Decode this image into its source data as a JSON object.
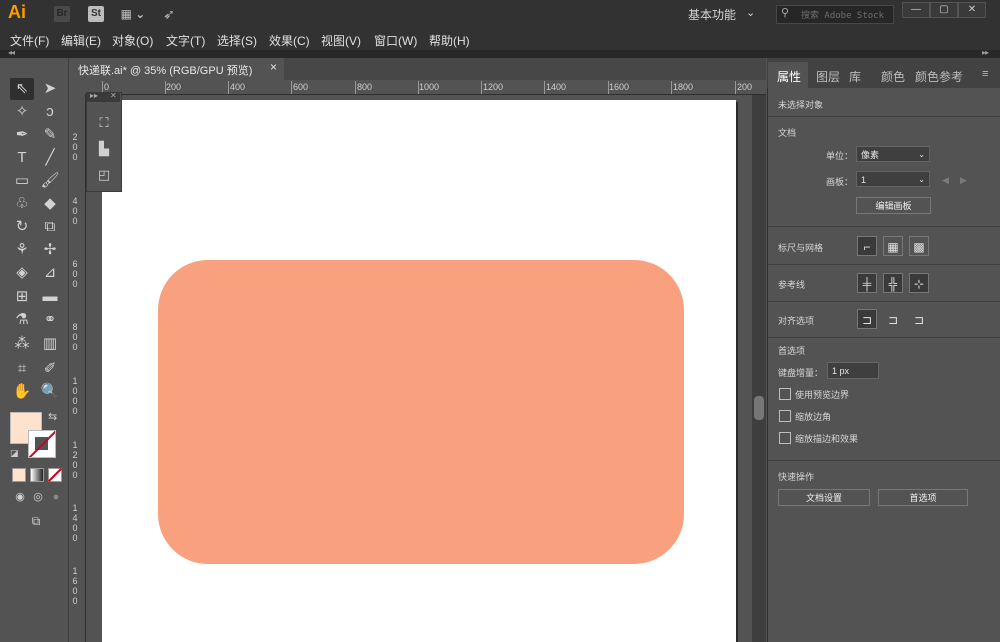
{
  "app": {
    "logo": "Ai",
    "bridge_icon": "Br",
    "stock_icon": "St",
    "layout_icon": "layout-grid-icon",
    "rocket_icon": "rocket-icon",
    "workspace": "基本功能",
    "stock_search_placeholder": "搜索 Adobe Stock",
    "window_controls": [
      "minimize",
      "maximize",
      "close"
    ]
  },
  "menu": [
    "文件(F)",
    "编辑(E)",
    "对象(O)",
    "文字(T)",
    "选择(S)",
    "效果(C)",
    "视图(V)",
    "窗口(W)",
    "帮助(H)"
  ],
  "document_tab": {
    "title": "快递联.ai* @ 35% (RGB/GPU 预览)",
    "close": "×"
  },
  "ruler_h": [
    "0",
    "200",
    "400",
    "600",
    "800",
    "1000",
    "1200",
    "1400",
    "1600",
    "1800",
    "200"
  ],
  "ruler_v": [
    "2 0 0",
    "4 0 0",
    "6 0 0",
    "8 0 0",
    "1 0 0 0",
    "1 2 0 0",
    "1 4 0 0",
    "1 6 0 0"
  ],
  "artboard": {
    "shape_fill": "#f9a07e",
    "fill_swatch": "#fde2cd"
  },
  "right_panel": {
    "tabs": [
      "属性",
      "图层",
      "库",
      "颜色",
      "颜色参考"
    ],
    "active_tab": "属性",
    "no_selection": "未选择对象",
    "doc_section": "文档",
    "unit_label": "单位：",
    "unit_value": "像素",
    "artboard_label": "画板：",
    "artboard_value": "1",
    "edit_artboard_btn": "编辑画板",
    "rulers_grids": "标尺与网格",
    "guides": "参考线",
    "align_options": "对齐选项",
    "preferences": "首选项",
    "keyboard_increment_label": "键盘增量：",
    "keyboard_increment_value": "1 px",
    "use_preview_bounds": "使用预览边界",
    "scale_corners": "缩放边角",
    "scale_strokes_effects": "缩放描边和效果",
    "quick_actions": "快速操作",
    "doc_setup_btn": "文档设置",
    "prefs_btn": "首选项"
  },
  "colors": {
    "accent_logo": "#ff9a00",
    "ui_bg": "#535353",
    "title_bg": "#323232"
  }
}
